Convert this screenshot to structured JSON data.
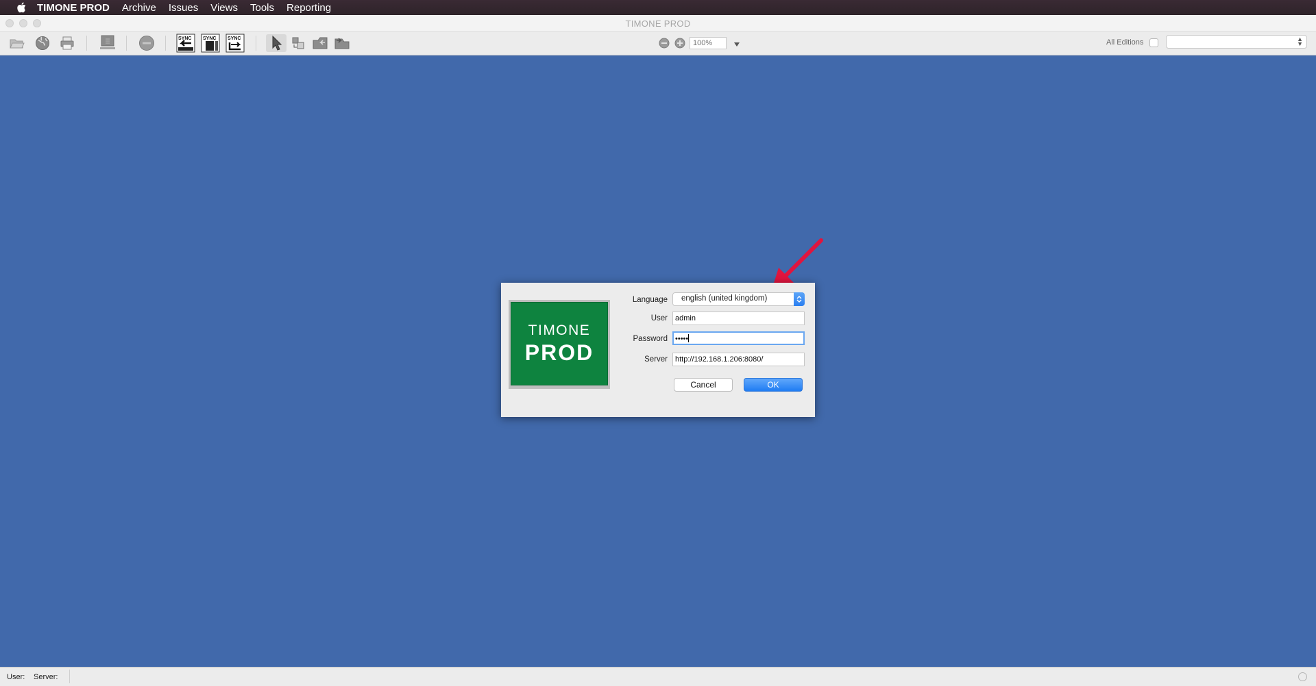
{
  "menubar": {
    "app_name": "TIMONE PROD",
    "items": [
      "Archive",
      "Issues",
      "Views",
      "Tools",
      "Reporting"
    ]
  },
  "window": {
    "title": "TIMONE PROD"
  },
  "toolbar": {
    "zoom_value": "100%",
    "editions_label": "All Editions",
    "sync_label": "SYNC",
    "edition_select_value": ""
  },
  "login": {
    "logo_line1": "TIMONE",
    "logo_line2": "PROD",
    "language_label": "Language",
    "language_value": "english (united kingdom)",
    "user_label": "User",
    "user_value": "admin",
    "password_label": "Password",
    "password_value": "•••••",
    "server_label": "Server",
    "server_value": "http://192.168.1.206:8080/",
    "cancel_label": "Cancel",
    "ok_label": "OK"
  },
  "statusbar": {
    "user_label": "User:",
    "server_label": "Server:"
  },
  "colors": {
    "desktop": "#4169ab",
    "logo_green": "#0e833f",
    "accent_blue": "#1f7cf3",
    "annotation_red": "#e0153f"
  }
}
